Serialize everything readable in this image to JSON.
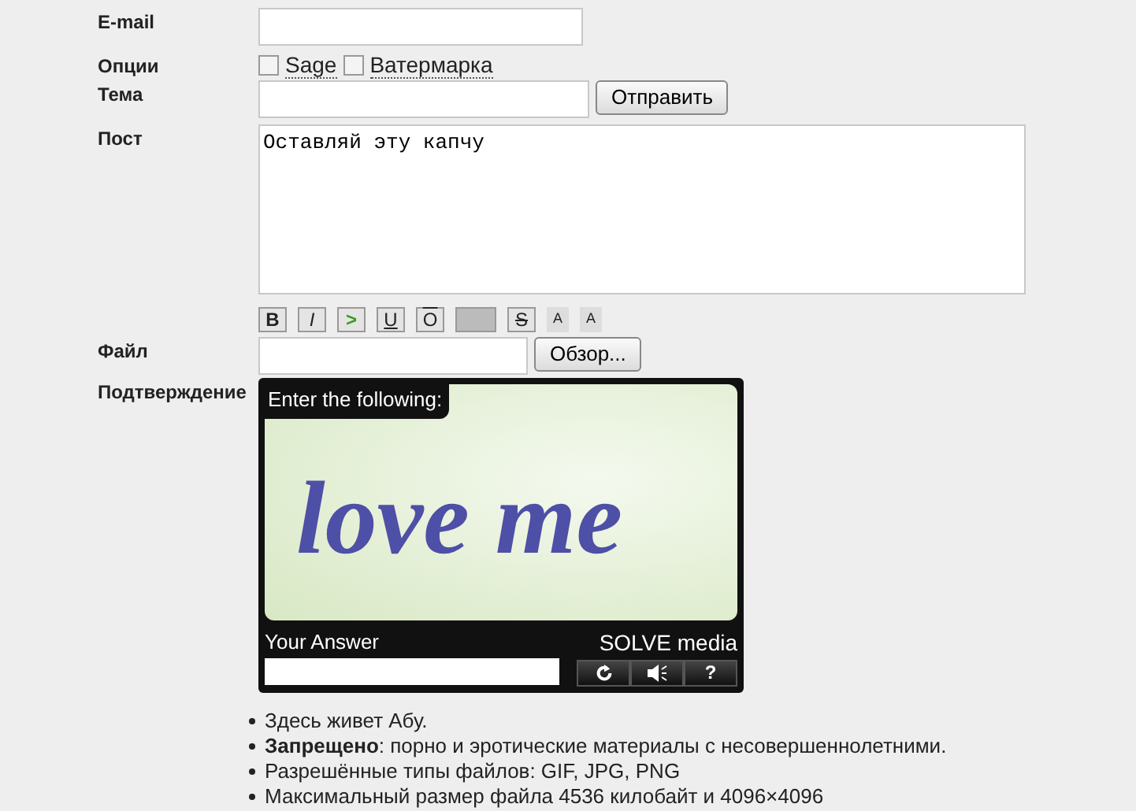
{
  "form": {
    "email": {
      "label": "E-mail"
    },
    "options": {
      "label": "Опции",
      "items": [
        {
          "label": "Sage",
          "checked": false
        },
        {
          "label": "Ватермарка",
          "checked": false
        }
      ]
    },
    "subject": {
      "label": "Тема",
      "button": "Отправить"
    },
    "post": {
      "label": "Пост",
      "value": "Оставляй эту капчу"
    },
    "toolbar": [
      {
        "kind": "bold",
        "text": "B"
      },
      {
        "kind": "italic",
        "text": "I"
      },
      {
        "kind": "quote",
        "text": ">"
      },
      {
        "kind": "underline",
        "text": "U"
      },
      {
        "kind": "overline",
        "text": "O"
      },
      {
        "kind": "spoiler"
      },
      {
        "kind": "strike",
        "text": "S"
      },
      {
        "kind": "sup",
        "text": "A"
      },
      {
        "kind": "sub",
        "text": "A"
      }
    ],
    "file": {
      "label": "Файл",
      "button": "Обзор..."
    },
    "captcha": {
      "label": "Подтверждение",
      "prompt": "Enter the following:",
      "challenge": "love me",
      "answer_label": "Your Answer",
      "brand": "SOLVE media",
      "help": "?"
    }
  },
  "rules": [
    {
      "text": "Здесь живет Абу."
    },
    {
      "text": "**Запрещено**: порно и эротические материалы с несовершеннолетними."
    },
    {
      "text": "Разрешённые типы файлов: GIF, JPG, PNG"
    },
    {
      "text": "Максимальный размер файла 4536 килобайт и 4096×4096"
    }
  ]
}
